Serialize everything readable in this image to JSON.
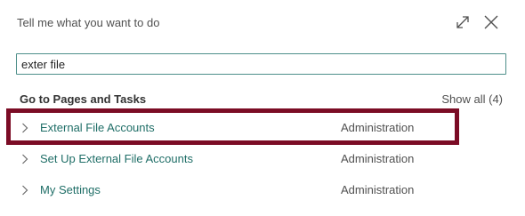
{
  "dialog": {
    "title": "Tell me what you want to do",
    "search": {
      "value": "exter file",
      "placeholder": ""
    }
  },
  "section": {
    "header": "Go to Pages and Tasks",
    "show_all": "Show all (4)"
  },
  "results": [
    {
      "label": "External File Accounts",
      "category": "Administration"
    },
    {
      "label": "Set Up External File Accounts",
      "category": "Administration"
    },
    {
      "label": "My Settings",
      "category": "Administration"
    }
  ],
  "colors": {
    "link": "#1f6e67",
    "highlight": "#7b0c25",
    "input_border": "#4e8f8a"
  },
  "icons": [
    "expand-icon",
    "close-icon",
    "chevron-right-icon"
  ]
}
